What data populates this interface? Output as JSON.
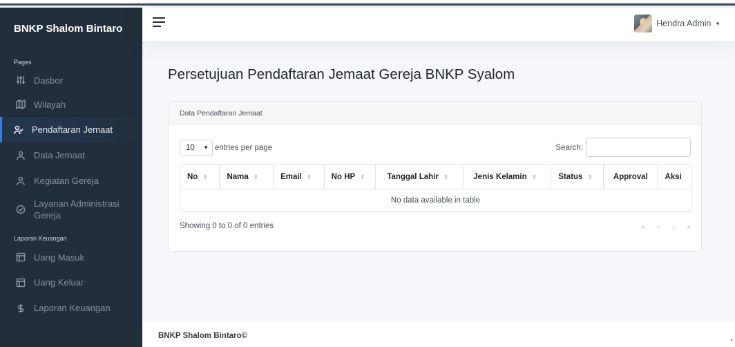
{
  "sidebar": {
    "brand": "BNKP Shalom Bintaro",
    "section_pages": "Pages",
    "section_finance": "Laporan Keuangan",
    "items": [
      {
        "label": "Dasbor",
        "icon": "sliders-icon"
      },
      {
        "label": "Wilayah",
        "icon": "map-icon"
      },
      {
        "label": "Pendaftaran Jemaat",
        "icon": "user-check-icon",
        "active": true
      },
      {
        "label": "Data Jemaat",
        "icon": "user-icon"
      },
      {
        "label": "Kegiatan Gereja",
        "icon": "user-icon"
      },
      {
        "label": "Layanan Administrasi Gereja",
        "icon": "check-circle-icon"
      }
    ],
    "finance_items": [
      {
        "label": "Uang Masuk",
        "icon": "layout-icon"
      },
      {
        "label": "Uang Keluar",
        "icon": "layout-icon"
      },
      {
        "label": "Laporan Keuangan",
        "icon": "dollar-sign-icon"
      }
    ]
  },
  "navbar": {
    "user_name": "Hendra Admin"
  },
  "main": {
    "title": "Persetujuan Pendaftaran Jemaat Gereja BNKP Syalom",
    "card_title": "Data Pendaftaran Jemaat",
    "length_value": "10",
    "length_label": "entries per page",
    "search_label": "Search:",
    "search_value": "",
    "columns": [
      "No",
      "Nama",
      "Email",
      "No HP",
      "Tanggal Lahir",
      "Jenis Kelamin",
      "Status",
      "Approval",
      "Aksi"
    ],
    "empty_message": "No data available in table",
    "info": "Showing 0 to 0 of 0 entries",
    "pager": [
      "«",
      "‹",
      "›",
      "»"
    ]
  },
  "footer": {
    "text": "BNKP Shalom Bintaro©"
  },
  "colors": {
    "sidebar_bg": "#222e3c",
    "accent": "#3b7ddd"
  }
}
